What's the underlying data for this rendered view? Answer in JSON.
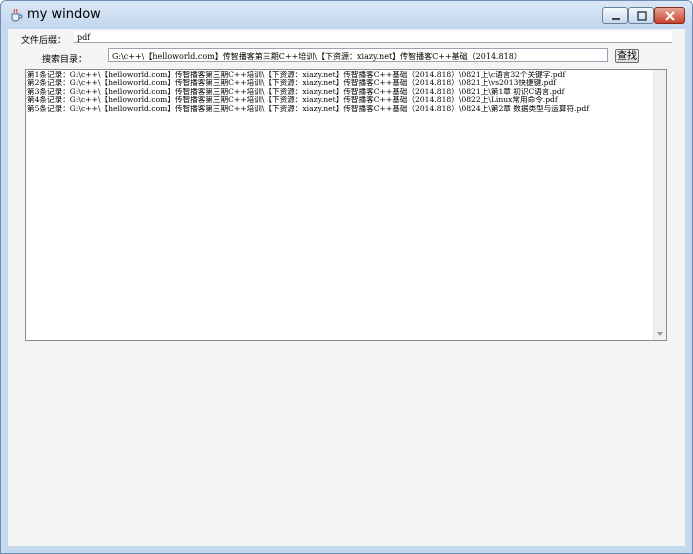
{
  "window": {
    "title": "my window"
  },
  "form": {
    "suffix_label": "文件后缀：",
    "suffix_value": "pdf",
    "dir_label": "搜索目录：",
    "dir_value": "G:\\c++\\【helloworld.com】传智播客第三期C++培训\\【下资源：xiazy.net】传智播客C++基础（2014.818）",
    "search_button": "查找"
  },
  "results": [
    "第1条记录：G:\\c++\\【helloworld.com】传智播客第三期C++培训\\【下资源：xiazy.net】传智播客C++基础（2014.818）\\0821上\\c语言32个关键字.pdf",
    "第2条记录：G:\\c++\\【helloworld.com】传智播客第三期C++培训\\【下资源：xiazy.net】传智播客C++基础（2014.818）\\0821上\\vs2013快捷键.pdf",
    "第3条记录：G:\\c++\\【helloworld.com】传智播客第三期C++培训\\【下资源：xiazy.net】传智播客C++基础（2014.818）\\0821上\\第1章 初识C语言.pdf",
    "第4条记录：G:\\c++\\【helloworld.com】传智播客第三期C++培训\\【下资源：xiazy.net】传智播客C++基础（2014.818）\\0822上\\Linux常用命令.pdf",
    "第5条记录：G:\\c++\\【helloworld.com】传智播客第三期C++培训\\【下资源：xiazy.net】传智播客C++基础（2014.818）\\0824上\\第2章 数据类型与运算符.pdf"
  ]
}
